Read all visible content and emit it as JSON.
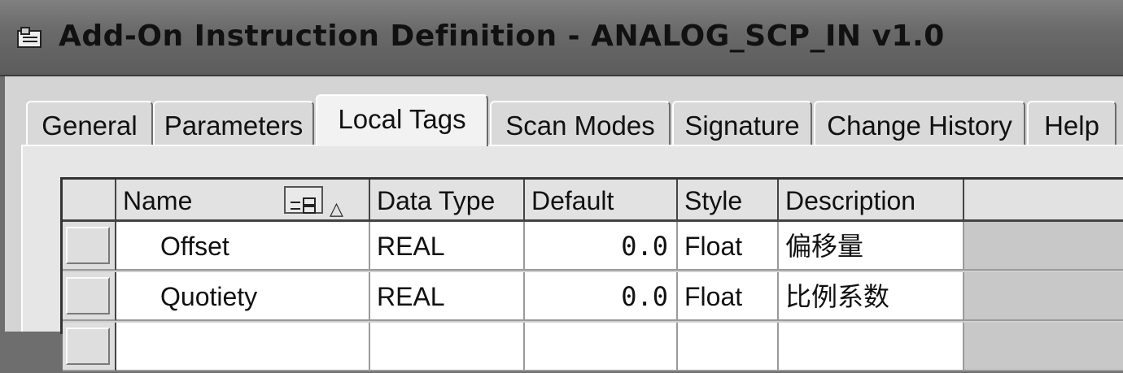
{
  "window": {
    "title": "Add-On Instruction Definition - ANALOG_SCP_IN v1.0",
    "icon": "aoi-definition-icon"
  },
  "tabs": [
    {
      "label": "General",
      "active": false
    },
    {
      "label": "Parameters",
      "active": false
    },
    {
      "label": "Local Tags",
      "active": true
    },
    {
      "label": "Scan Modes",
      "active": false
    },
    {
      "label": "Signature",
      "active": false
    },
    {
      "label": "Change History",
      "active": false
    },
    {
      "label": "Help",
      "active": false
    }
  ],
  "table": {
    "columns": [
      "Name",
      "Data Type",
      "Default",
      "Style",
      "Description"
    ],
    "sort_icons": {
      "filter": "column-filter-icon",
      "sort": "sort-ascending-icon"
    },
    "rows": [
      {
        "name": "Offset",
        "data_type": "REAL",
        "default": "0.0",
        "style": "Float",
        "description": "偏移量"
      },
      {
        "name": "Quotiety",
        "data_type": "REAL",
        "default": "0.0",
        "style": "Float",
        "description": "比例系数"
      }
    ]
  }
}
